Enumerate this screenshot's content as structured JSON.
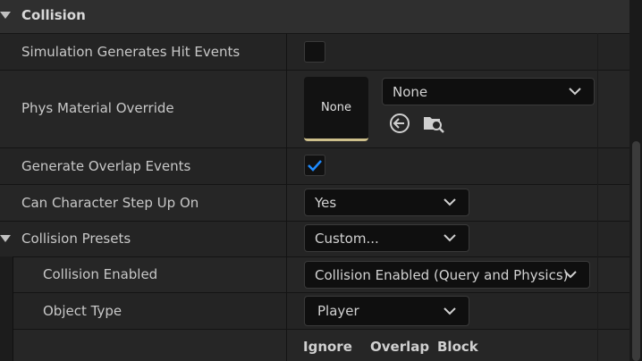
{
  "section": {
    "title": "Collision"
  },
  "rows": {
    "sim_hit": {
      "label": "Simulation Generates Hit Events",
      "checked": false
    },
    "phys_material": {
      "label": "Phys Material Override",
      "thumbnail_text": "None",
      "selected": "None"
    },
    "overlap": {
      "label": "Generate Overlap Events",
      "checked": true
    },
    "step_up": {
      "label": "Can Character Step Up On",
      "selected": "Yes"
    },
    "presets": {
      "label": "Collision Presets",
      "selected": "Custom..."
    },
    "enabled": {
      "label": "Collision Enabled",
      "selected": "Collision Enabled (Query and Physics)"
    },
    "object_type": {
      "label": "Object Type",
      "selected": "Player"
    }
  },
  "response_columns": [
    "Ignore",
    "Overlap",
    "Block"
  ],
  "icons": {
    "use_selected": "arrow-left-circle-icon",
    "browse": "folder-search-icon",
    "dropdown": "chevron-down-icon",
    "collapse": "triangle-down-icon",
    "check": "checkmark-icon"
  },
  "colors": {
    "accent_check": "#1e8bff",
    "thumbnail_underline": "#cdbf8b"
  }
}
